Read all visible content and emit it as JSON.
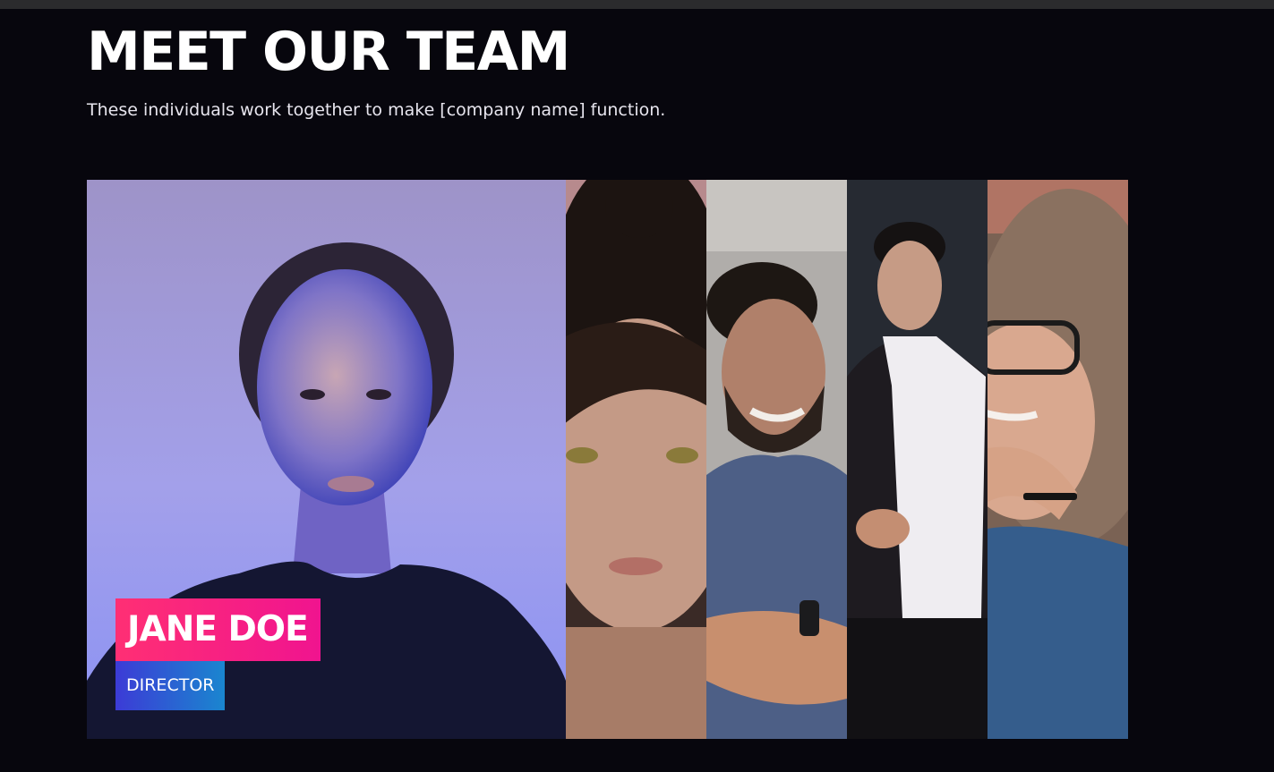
{
  "header": {
    "title": "MEET OUR TEAM",
    "subtitle": "These individuals work together to make [company name] function."
  },
  "team": {
    "featured": {
      "name": "JANE DOE",
      "role": "DIRECTOR"
    }
  },
  "colors": {
    "background": "#07060d",
    "name_tag_start": "#ff2f74",
    "name_tag_end": "#f0148f",
    "role_tag_start": "#3c3bd6",
    "role_tag_end": "#1a86cf"
  }
}
